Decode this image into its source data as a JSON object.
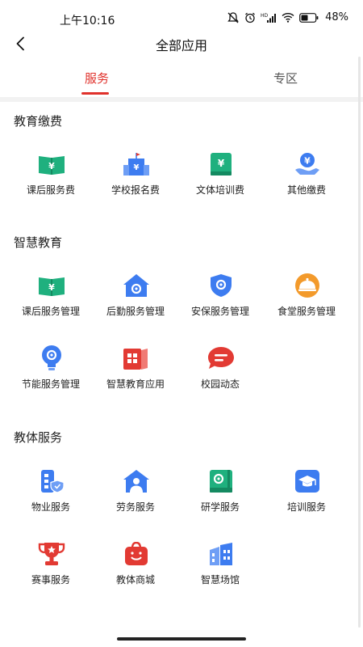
{
  "status_bar": {
    "time": "上午10:16",
    "battery": "48%"
  },
  "header": {
    "title": "全部应用"
  },
  "tabs": [
    {
      "label": "服务",
      "active": true
    },
    {
      "label": "专区",
      "active": false
    }
  ],
  "sections": [
    {
      "title": "教育缴费",
      "items": [
        {
          "label": "课后服务费",
          "icon": "book-yuan-icon"
        },
        {
          "label": "学校报名费",
          "icon": "school-building-icon"
        },
        {
          "label": "文体培训费",
          "icon": "notebook-yuan-icon"
        },
        {
          "label": "其他缴费",
          "icon": "hand-coin-icon"
        }
      ]
    },
    {
      "title": "智慧教育",
      "items": [
        {
          "label": "课后服务管理",
          "icon": "book-yuan-icon"
        },
        {
          "label": "后勤服务管理",
          "icon": "house-gear-icon"
        },
        {
          "label": "安保服务管理",
          "icon": "shield-gear-icon"
        },
        {
          "label": "食堂服务管理",
          "icon": "food-cloche-icon"
        },
        {
          "label": "节能服务管理",
          "icon": "bulb-gear-icon"
        },
        {
          "label": "智慧教育应用",
          "icon": "book-grid-icon"
        },
        {
          "label": "校园动态",
          "icon": "chat-bubble-icon"
        }
      ]
    },
    {
      "title": "教体服务",
      "items": [
        {
          "label": "物业服务",
          "icon": "property-shield-icon"
        },
        {
          "label": "劳务服务",
          "icon": "house-worker-icon"
        },
        {
          "label": "研学服务",
          "icon": "notebook-gear-icon"
        },
        {
          "label": "培训服务",
          "icon": "graduation-cap-icon"
        },
        {
          "label": "赛事服务",
          "icon": "trophy-icon"
        },
        {
          "label": "教体商城",
          "icon": "shopping-bag-icon"
        },
        {
          "label": "智慧场馆",
          "icon": "buildings-icon"
        }
      ]
    }
  ],
  "colors": {
    "accent": "#e0312b",
    "green": "#1fb07e",
    "blue": "#3d7cf0",
    "orange": "#f39a2b",
    "red": "#e23a33"
  }
}
